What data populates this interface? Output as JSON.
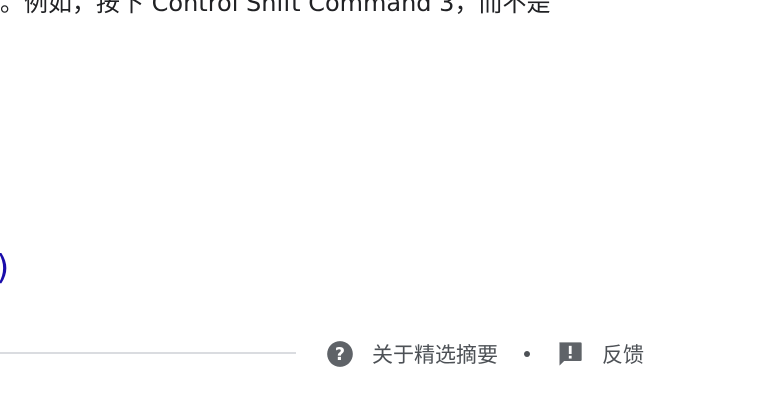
{
  "snippet": {
    "partial_text": "。例如，按下 Control Shift Command 3，而不是"
  },
  "link": {
    "partial_text": ")"
  },
  "footer": {
    "about_label": "关于精选摘要",
    "about_icon": "help-circle-icon",
    "separator": "•",
    "feedback_label": "反馈",
    "feedback_icon": "feedback-icon",
    "link_color": "#1a0dab",
    "text_color": "#4d5156",
    "divider_color": "#dadce0"
  }
}
